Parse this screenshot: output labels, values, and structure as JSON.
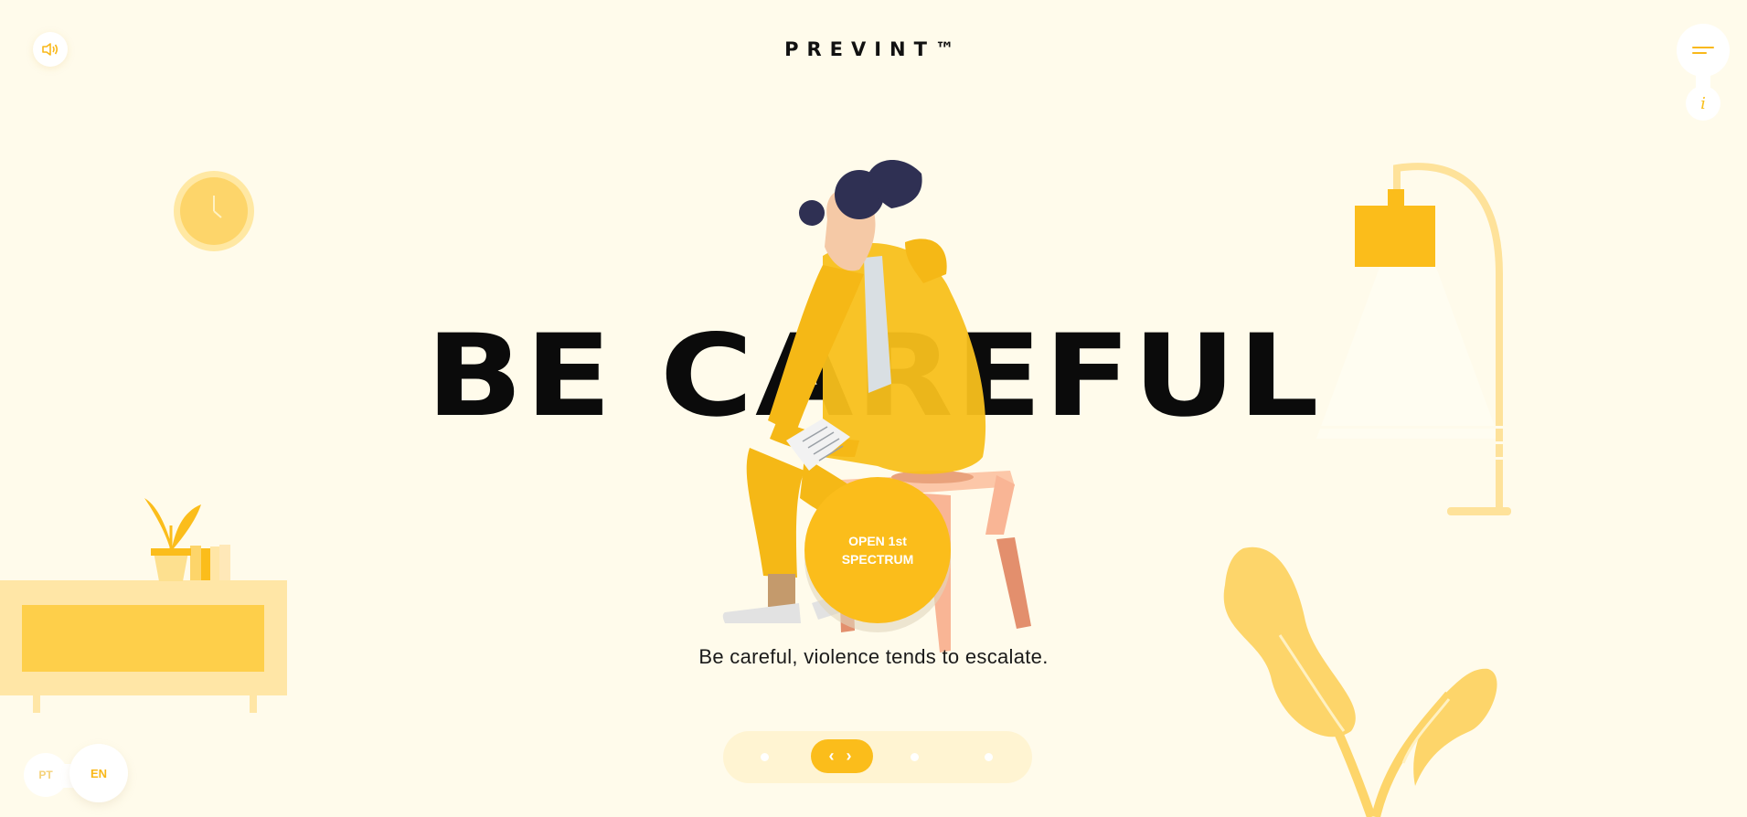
{
  "header": {
    "logo": "PREVINT™",
    "sound_icon": "speaker-icon",
    "menu_icon": "hamburger-menu-icon",
    "info_label": "i"
  },
  "hero": {
    "headline": "BE CAREFUL",
    "cta_label": "OPEN 1st SPECTRUM",
    "caption": "Be careful, violence tends to escalate."
  },
  "pager": {
    "total_steps": 4,
    "active_step": 2,
    "active_label": "‹ ›"
  },
  "language": {
    "options": [
      "PT",
      "EN"
    ],
    "selected": "EN"
  },
  "colors": {
    "background": "#fffbeb",
    "accent": "#fbbd1b",
    "light_accent": "#fdd459",
    "pale_accent": "#ffe8a3",
    "text": "#111111",
    "hair": "#2f3053",
    "skin": "#f7c9a6",
    "stool": "#f8b896"
  }
}
